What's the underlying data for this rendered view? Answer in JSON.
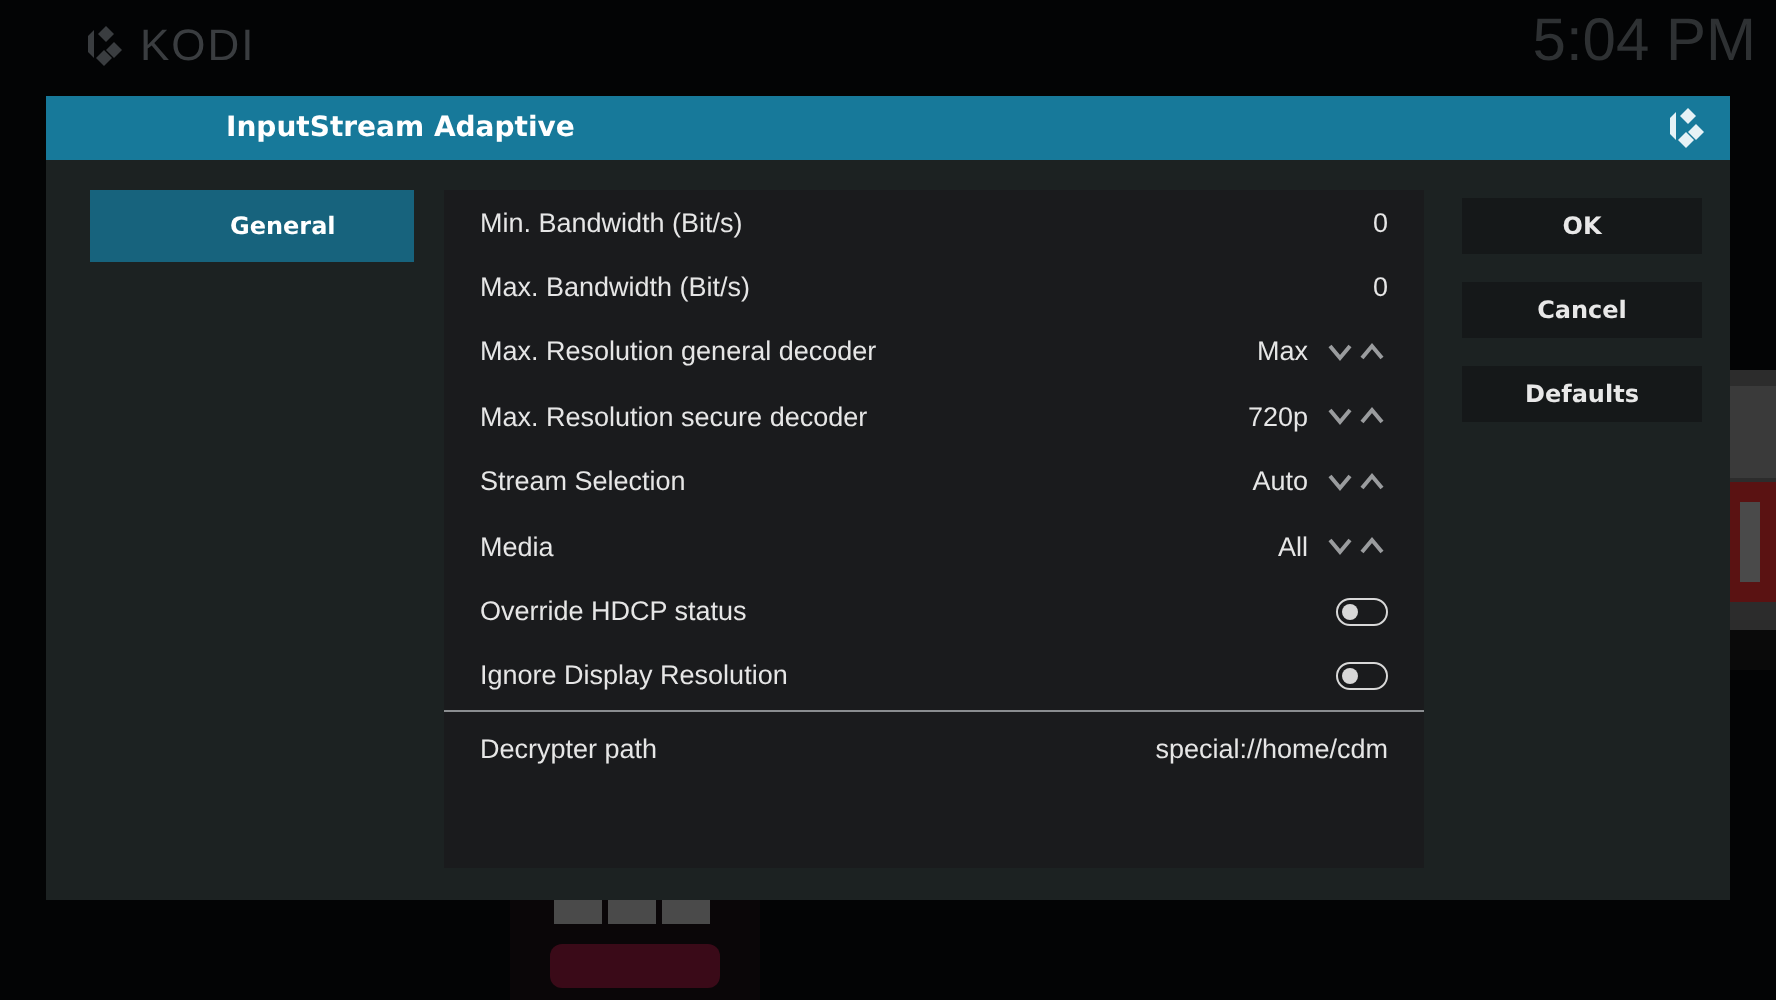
{
  "background": {
    "logo": "KODI",
    "clock": "5:04 PM"
  },
  "dialog": {
    "title": "InputStream Adaptive",
    "categories": [
      {
        "label": "General",
        "selected": true
      }
    ],
    "settings": [
      {
        "kind": "value",
        "label": "Min. Bandwidth (Bit/s)",
        "value": "0"
      },
      {
        "kind": "value",
        "label": "Max. Bandwidth (Bit/s)",
        "value": "0"
      },
      {
        "kind": "spinner",
        "label": "Max. Resolution general decoder",
        "value": "Max"
      },
      {
        "kind": "spinner",
        "label": "Max. Resolution secure decoder",
        "value": "720p"
      },
      {
        "kind": "spinner",
        "label": "Stream Selection",
        "value": "Auto"
      },
      {
        "kind": "spinner",
        "label": "Media",
        "value": "All"
      },
      {
        "kind": "toggle",
        "label": "Override HDCP status",
        "on": false
      },
      {
        "kind": "toggle",
        "label": "Ignore Display Resolution",
        "on": false
      }
    ],
    "path_setting": {
      "label": "Decrypter path",
      "value": "special://home/cdm"
    },
    "buttons": [
      "OK",
      "Cancel",
      "Defaults"
    ]
  }
}
